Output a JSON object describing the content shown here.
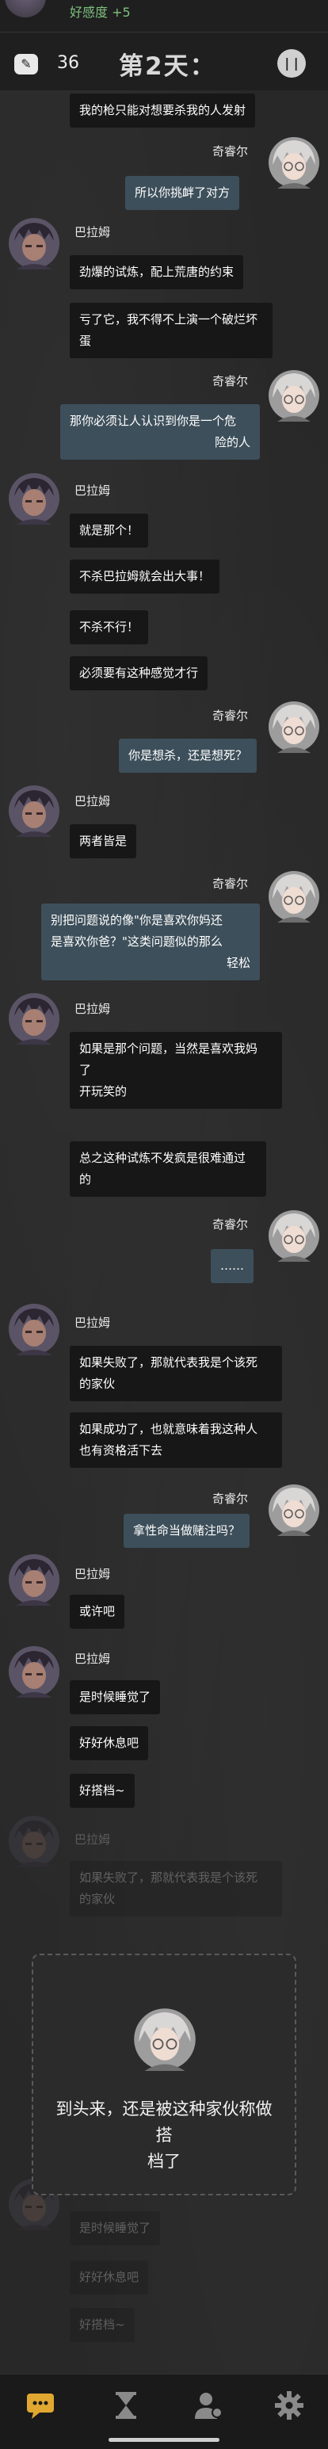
{
  "header": {
    "favorability": "好感度 +5",
    "note_count": "36",
    "day_title": "第2天："
  },
  "messages": [
    {
      "speaker": "",
      "side": "left",
      "lines": [
        "我的枪只能对想要杀我的人发射"
      ]
    },
    {
      "speaker": "奇睿尔",
      "side": "right",
      "lines": [
        "所以你挑衅了对方"
      ]
    },
    {
      "speaker": "巴拉姆",
      "side": "left",
      "lines": [
        "劲爆的试炼，配上荒唐的约束"
      ]
    },
    {
      "speaker": "",
      "side": "left",
      "lines": [
        "亏了它，我不得不上演一个破烂坏",
        "蛋"
      ]
    },
    {
      "speaker": "奇睿尔",
      "side": "right",
      "lines": [
        "那你必须让人认识到你是一个危",
        "险的人"
      ]
    },
    {
      "speaker": "巴拉姆",
      "side": "left",
      "lines": [
        "就是那个！"
      ]
    },
    {
      "speaker": "",
      "side": "left",
      "lines": [
        "不杀巴拉姆就会出大事！"
      ]
    },
    {
      "speaker": "",
      "side": "left",
      "lines": [
        "不杀不行！"
      ]
    },
    {
      "speaker": "",
      "side": "left",
      "lines": [
        "必须要有这种感觉才行"
      ]
    },
    {
      "speaker": "奇睿尔",
      "side": "right",
      "lines": [
        "你是想杀，还是想死？"
      ]
    },
    {
      "speaker": "巴拉姆",
      "side": "left",
      "lines": [
        "两者皆是"
      ]
    },
    {
      "speaker": "奇睿尔",
      "side": "right",
      "lines": [
        "别把问题说的像\"你是喜欢你妈还",
        "是喜欢你爸？\"这类问题似的那么",
        "轻松"
      ]
    },
    {
      "speaker": "巴拉姆",
      "side": "left",
      "lines": [
        "如果是那个问题，当然是喜欢我妈",
        "了",
        "开玩笑的"
      ]
    },
    {
      "speaker": "",
      "side": "left",
      "lines": [
        "总之这种试炼不发疯是很难通过",
        "的"
      ]
    },
    {
      "speaker": "奇睿尔",
      "side": "right",
      "lines": [
        "……"
      ]
    },
    {
      "speaker": "巴拉姆",
      "side": "left",
      "lines": [
        "如果失败了，那就代表我是个该死",
        "的家伙"
      ]
    },
    {
      "speaker": "",
      "side": "left",
      "lines": [
        "如果成功了，也就意味着我这种人",
        "也有资格活下去"
      ]
    },
    {
      "speaker": "奇睿尔",
      "side": "right",
      "lines": [
        "拿性命当做赌注吗？"
      ]
    },
    {
      "speaker": "巴拉姆",
      "side": "left",
      "lines": [
        "或许吧"
      ]
    },
    {
      "speaker": "巴拉姆",
      "side": "left",
      "lines": [
        "是时候睡觉了"
      ]
    },
    {
      "speaker": "",
      "side": "left",
      "lines": [
        "好好休息吧"
      ]
    },
    {
      "speaker": "",
      "side": "left",
      "lines": [
        "好搭档~"
      ]
    }
  ],
  "faded_messages": [
    {
      "speaker": "巴拉姆",
      "lines": [
        "如果失败了，那就代表我是个该死",
        "的家伙"
      ]
    },
    {
      "lines": [
        "是时候睡觉了"
      ]
    },
    {
      "lines": [
        "好好休息吧"
      ]
    },
    {
      "lines": [
        "好搭档~"
      ]
    }
  ],
  "overlay": {
    "text_line1": "到头来，还是被这种家伙称做搭",
    "text_line2": "档了"
  },
  "nav": [
    {
      "icon": "chat-icon",
      "active": true
    },
    {
      "icon": "hourglass-icon",
      "active": false
    },
    {
      "icon": "profile-icon",
      "active": false
    },
    {
      "icon": "gear-icon",
      "active": false
    }
  ],
  "colors": {
    "favor_green": "#7ec07e",
    "bubble_dark": "#171717",
    "bubble_blue": "#3d4f5a",
    "nav_active": "#e0a830"
  }
}
